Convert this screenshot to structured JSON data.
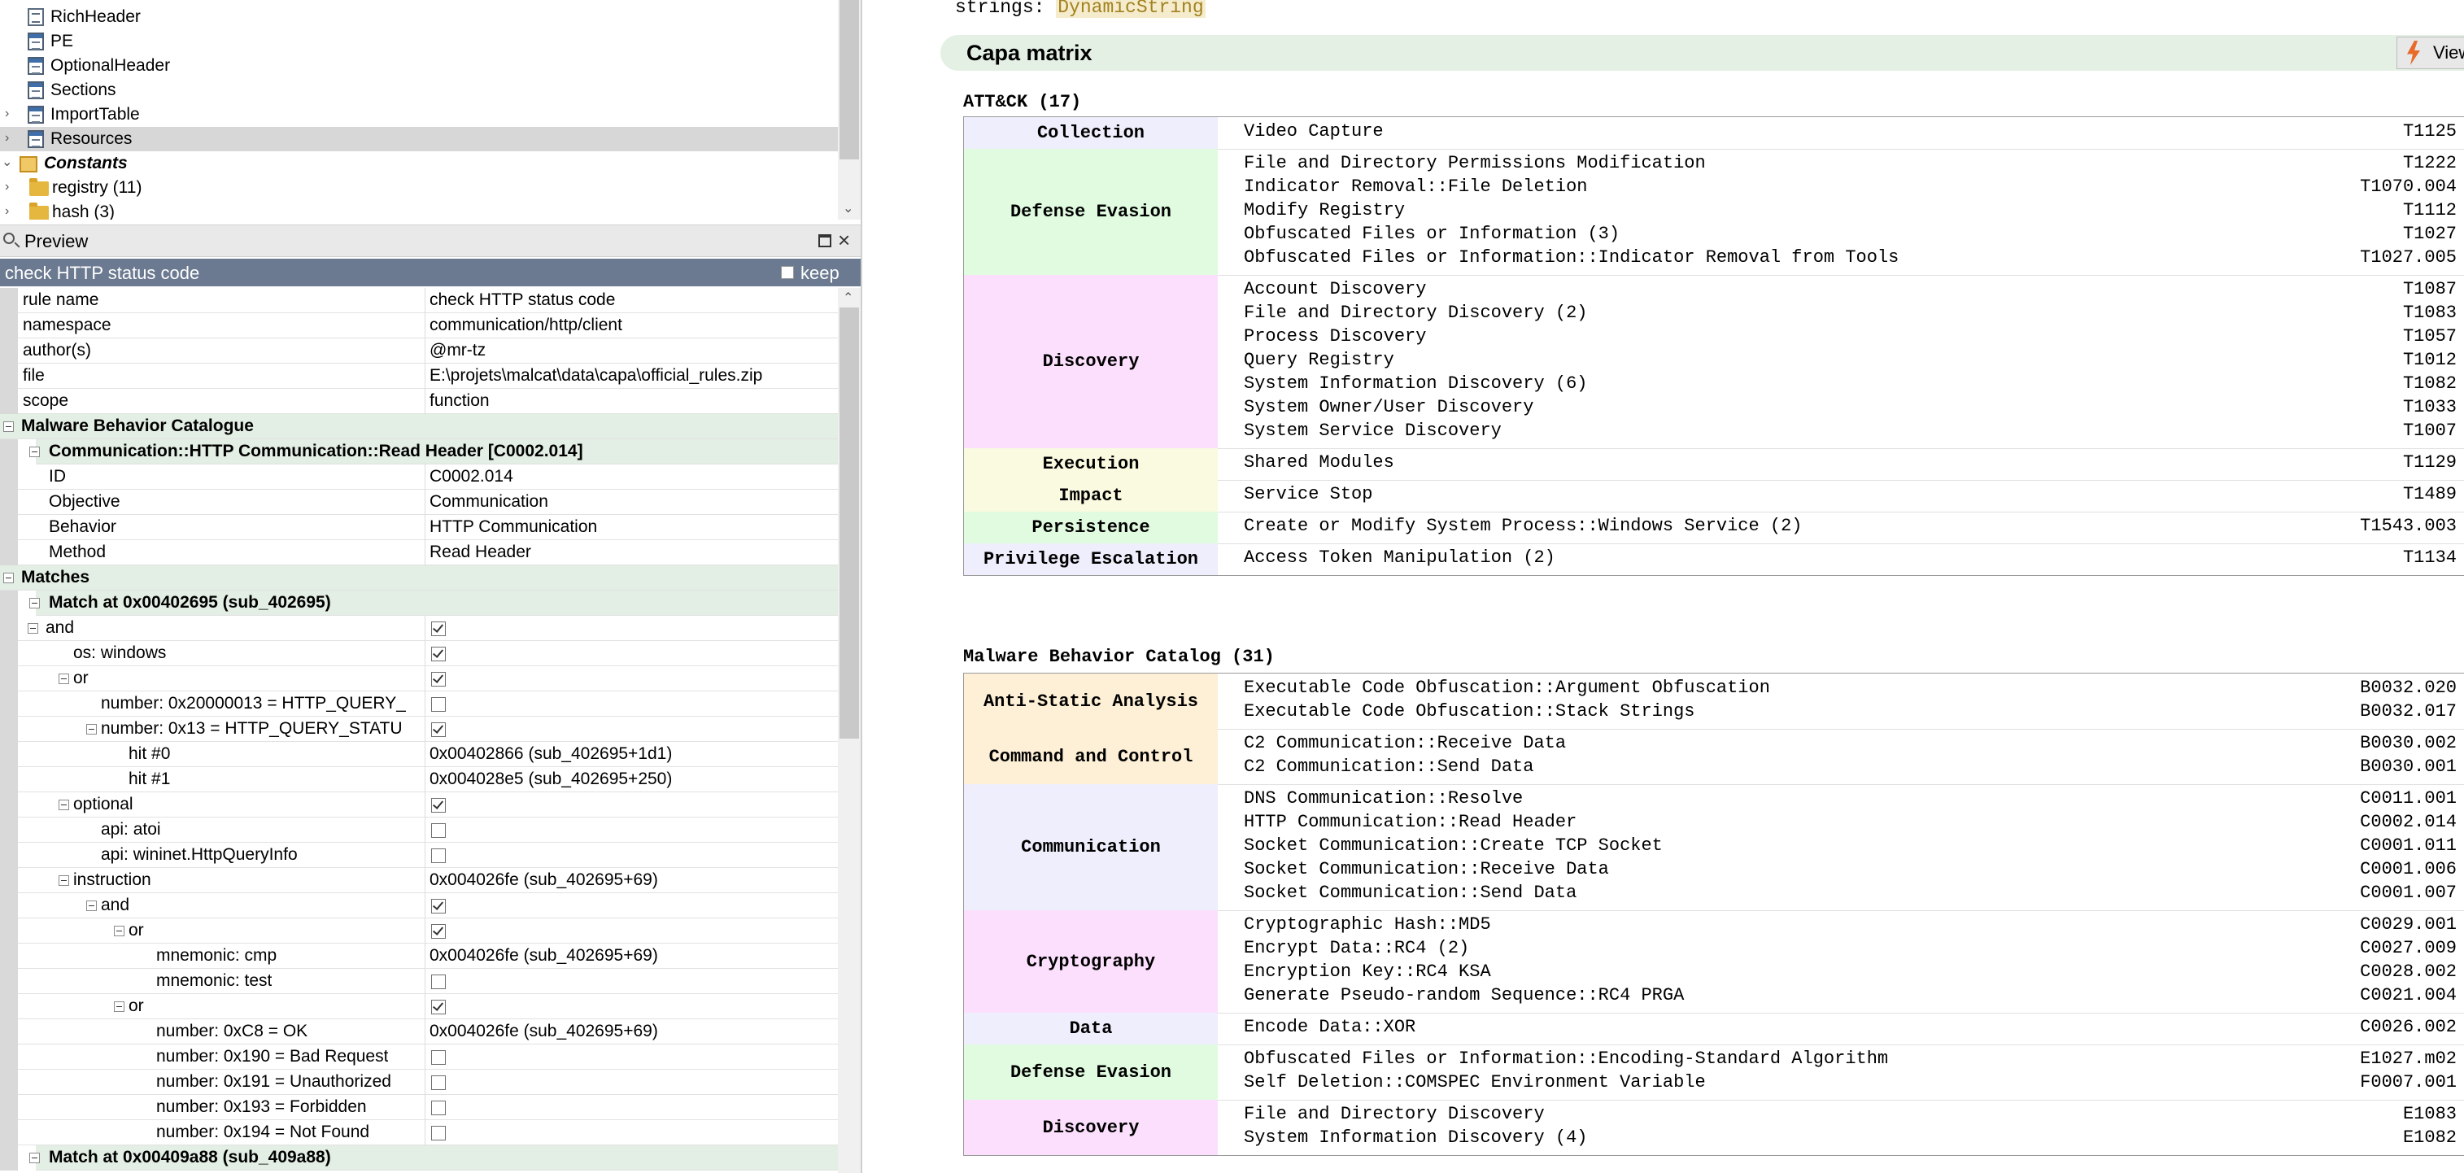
{
  "tree": {
    "items": [
      {
        "label": "RichHeader",
        "icon": "doc-icon",
        "expander": false,
        "selected": false,
        "bold": false
      },
      {
        "label": "PE",
        "icon": "table-icon",
        "expander": false,
        "selected": false,
        "bold": false
      },
      {
        "label": "OptionalHeader",
        "icon": "table-icon",
        "expander": false,
        "selected": false,
        "bold": false
      },
      {
        "label": "Sections",
        "icon": "table-icon",
        "expander": false,
        "selected": false,
        "bold": false
      },
      {
        "label": "ImportTable",
        "icon": "table-icon",
        "expander": true,
        "selected": false,
        "bold": false
      },
      {
        "label": "Resources",
        "icon": "table-icon",
        "expander": true,
        "selected": true,
        "bold": false
      },
      {
        "label": "Constants",
        "icon": "constants-icon",
        "expander": true,
        "selected": false,
        "bold": true
      },
      {
        "label": "registry (11)",
        "icon": "folder-icon",
        "expander": true,
        "selected": false,
        "bold": false
      },
      {
        "label": "hash (3)",
        "icon": "folder-icon",
        "expander": true,
        "selected": false,
        "bold": false
      }
    ]
  },
  "preview": {
    "title": "Preview"
  },
  "rule_header": {
    "title": "check HTTP status code",
    "keep_label": "keep"
  },
  "grid": {
    "rows": [
      {
        "type": "kv",
        "key": "rule name",
        "value": "check HTTP status code"
      },
      {
        "type": "kv",
        "key": "namespace",
        "value": "communication/http/client"
      },
      {
        "type": "kv",
        "key": "author(s)",
        "value": "@mr-tz"
      },
      {
        "type": "kv",
        "key": "file",
        "value": "E:\\projets\\malcat\\data\\capa\\official_rules.zip"
      },
      {
        "type": "kv",
        "key": "scope",
        "value": "function"
      },
      {
        "type": "section",
        "key": "Malware Behavior Catalogue",
        "level": 0
      },
      {
        "type": "section",
        "key": "Communication::HTTP Communication::Read Header [C0002.014]",
        "level": 1
      },
      {
        "type": "kv",
        "key": "ID",
        "value": "C0002.014",
        "indent": 1
      },
      {
        "type": "kv",
        "key": "Objective",
        "value": "Communication",
        "indent": 1
      },
      {
        "type": "kv",
        "key": "Behavior",
        "value": "HTTP Communication",
        "indent": 1
      },
      {
        "type": "kv",
        "key": "Method",
        "value": "Read Header",
        "indent": 1
      },
      {
        "type": "section",
        "key": "Matches",
        "level": 0
      },
      {
        "type": "section",
        "key": "Match at 0x00402695 (sub_402695)",
        "level": 1
      },
      {
        "type": "node",
        "key": "and",
        "indent": 1,
        "box": true,
        "check": true
      },
      {
        "type": "node",
        "key": "os: windows",
        "indent": 2,
        "box": false,
        "check": true
      },
      {
        "type": "node",
        "key": "or",
        "indent": 2,
        "box": true,
        "check": true
      },
      {
        "type": "node",
        "key": "number: 0x20000013 = HTTP_QUERY_",
        "indent": 3,
        "box": false,
        "check": false
      },
      {
        "type": "node",
        "key": "number: 0x13 = HTTP_QUERY_STATU",
        "indent": 3,
        "box": true,
        "check": true
      },
      {
        "type": "node",
        "key": "hit #0",
        "indent": 4,
        "box": false,
        "value": "0x00402866 (sub_402695+1d1)"
      },
      {
        "type": "node",
        "key": "hit #1",
        "indent": 4,
        "box": false,
        "value": "0x004028e5 (sub_402695+250)"
      },
      {
        "type": "node",
        "key": "optional",
        "indent": 2,
        "box": true,
        "check": true
      },
      {
        "type": "node",
        "key": "api: atoi",
        "indent": 3,
        "box": false,
        "check": false
      },
      {
        "type": "node",
        "key": "api: wininet.HttpQueryInfo",
        "indent": 3,
        "box": false,
        "check": false
      },
      {
        "type": "node",
        "key": "instruction",
        "indent": 2,
        "box": true,
        "value": "0x004026fe (sub_402695+69)"
      },
      {
        "type": "node",
        "key": "and",
        "indent": 3,
        "box": true,
        "check": true
      },
      {
        "type": "node",
        "key": "or",
        "indent": 4,
        "box": true,
        "check": true
      },
      {
        "type": "node",
        "key": "mnemonic: cmp",
        "indent": 5,
        "box": false,
        "value": "0x004026fe (sub_402695+69)"
      },
      {
        "type": "node",
        "key": "mnemonic: test",
        "indent": 5,
        "box": false,
        "check": false
      },
      {
        "type": "node",
        "key": "or",
        "indent": 4,
        "box": true,
        "check": true
      },
      {
        "type": "node",
        "key": "number: 0xC8 = OK",
        "indent": 5,
        "box": false,
        "value": "0x004026fe (sub_402695+69)"
      },
      {
        "type": "node",
        "key": "number: 0x190 = Bad Request",
        "indent": 5,
        "box": false,
        "check": false
      },
      {
        "type": "node",
        "key": "number: 0x191 = Unauthorized",
        "indent": 5,
        "box": false,
        "check": false
      },
      {
        "type": "node",
        "key": "number: 0x193 = Forbidden",
        "indent": 5,
        "box": false,
        "check": false
      },
      {
        "type": "node",
        "key": "number: 0x194 = Not Found",
        "indent": 5,
        "box": false,
        "check": false
      },
      {
        "type": "section",
        "key": "Match at 0x00409a88 (sub_409a88)",
        "level": 1
      }
    ]
  },
  "report": {
    "strings_label": "strings:",
    "strings_value": "DynamicString",
    "capa_title": "Capa matrix",
    "view_rules_label": "View rules",
    "attack": {
      "title": "ATT&CK (17)",
      "categories": [
        {
          "name": "Collection",
          "color": "#eeeefc",
          "items": [
            {
              "label": "Video Capture",
              "id": "T1125"
            }
          ]
        },
        {
          "name": "Defense Evasion",
          "color": "#e0fbe0",
          "items": [
            {
              "label": "File and Directory Permissions Modification",
              "id": "T1222"
            },
            {
              "label": "Indicator Removal::File Deletion",
              "id": "T1070.004"
            },
            {
              "label": "Modify Registry",
              "id": "T1112"
            },
            {
              "label": "Obfuscated Files or Information (3)",
              "id": "T1027"
            },
            {
              "label": "Obfuscated Files or Information::Indicator Removal from Tools",
              "id": "T1027.005"
            }
          ]
        },
        {
          "name": "Discovery",
          "color": "#fcdffc",
          "items": [
            {
              "label": "Account Discovery",
              "id": "T1087"
            },
            {
              "label": "File and Directory Discovery (2)",
              "id": "T1083"
            },
            {
              "label": "Process Discovery",
              "id": "T1057"
            },
            {
              "label": "Query Registry",
              "id": "T1012"
            },
            {
              "label": "System Information Discovery (6)",
              "id": "T1082"
            },
            {
              "label": "System Owner/User Discovery",
              "id": "T1033"
            },
            {
              "label": "System Service Discovery",
              "id": "T1007"
            }
          ]
        },
        {
          "name": "Execution",
          "color": "#fafae0",
          "items": [
            {
              "label": "Shared Modules",
              "id": "T1129"
            }
          ]
        },
        {
          "name": "Impact",
          "color": "#fafae0",
          "items": [
            {
              "label": "Service Stop",
              "id": "T1489"
            }
          ]
        },
        {
          "name": "Persistence",
          "color": "#e0fbe0",
          "items": [
            {
              "label": "Create or Modify System Process::Windows Service (2)",
              "id": "T1543.003"
            }
          ]
        },
        {
          "name": "Privilege Escalation",
          "color": "#eeeefc",
          "items": [
            {
              "label": "Access Token Manipulation (2)",
              "id": "T1134"
            }
          ]
        }
      ]
    },
    "mbc": {
      "title": "Malware Behavior Catalog (31)",
      "categories": [
        {
          "name": "Anti-Static Analysis",
          "color": "#fdf0d6",
          "items": [
            {
              "label": "Executable Code Obfuscation::Argument Obfuscation",
              "id": "B0032.020"
            },
            {
              "label": "Executable Code Obfuscation::Stack Strings",
              "id": "B0032.017"
            }
          ]
        },
        {
          "name": "Command and Control",
          "color": "#fdf0d6",
          "items": [
            {
              "label": "C2 Communication::Receive Data",
              "id": "B0030.002"
            },
            {
              "label": "C2 Communication::Send Data",
              "id": "B0030.001"
            }
          ]
        },
        {
          "name": "Communication",
          "color": "#eeeefc",
          "items": [
            {
              "label": "DNS Communication::Resolve",
              "id": "C0011.001"
            },
            {
              "label": "HTTP Communication::Read Header",
              "id": "C0002.014"
            },
            {
              "label": "Socket Communication::Create TCP Socket",
              "id": "C0001.011"
            },
            {
              "label": "Socket Communication::Receive Data",
              "id": "C0001.006"
            },
            {
              "label": "Socket Communication::Send Data",
              "id": "C0001.007"
            }
          ]
        },
        {
          "name": "Cryptography",
          "color": "#fcdffc",
          "items": [
            {
              "label": "Cryptographic Hash::MD5",
              "id": "C0029.001"
            },
            {
              "label": "Encrypt Data::RC4 (2)",
              "id": "C0027.009"
            },
            {
              "label": "Encryption Key::RC4 KSA",
              "id": "C0028.002"
            },
            {
              "label": "Generate Pseudo-random Sequence::RC4 PRGA",
              "id": "C0021.004"
            }
          ]
        },
        {
          "name": "Data",
          "color": "#eeeefc",
          "items": [
            {
              "label": "Encode Data::XOR",
              "id": "C0026.002"
            }
          ]
        },
        {
          "name": "Defense Evasion",
          "color": "#e0fbe0",
          "items": [
            {
              "label": "Obfuscated Files or Information::Encoding-Standard Algorithm",
              "id": "E1027.m02"
            },
            {
              "label": "Self Deletion::COMSPEC Environment Variable",
              "id": "F0007.001"
            }
          ]
        },
        {
          "name": "Discovery",
          "color": "#fcdffc",
          "items": [
            {
              "label": "File and Directory Discovery",
              "id": "E1083"
            },
            {
              "label": "System Information Discovery (4)",
              "id": "E1082"
            }
          ]
        }
      ]
    }
  }
}
